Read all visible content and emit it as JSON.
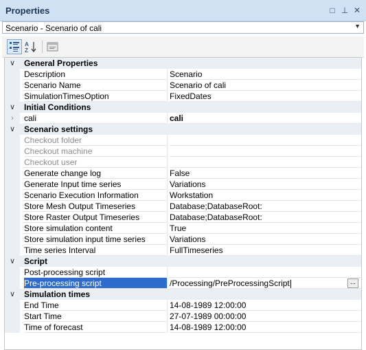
{
  "panel": {
    "title": "Properties",
    "controls": {
      "pin_icon": "□",
      "dock_icon": "⊥",
      "close_icon": "✕"
    }
  },
  "selector": {
    "value": "Scenario - Scenario of cali"
  },
  "toolbar": {
    "categorized_active": true
  },
  "grid": {
    "general": {
      "label": "General Properties",
      "description": {
        "name": "Description",
        "value": "Scenario"
      },
      "scenario_name": {
        "name": "Scenario Name",
        "value": "Scenario of cali"
      },
      "sim_times_option": {
        "name": "SimulationTimesOption",
        "value": "FixedDates"
      }
    },
    "initial": {
      "label": "Initial Conditions",
      "cali": {
        "name": "cali",
        "value": "cali"
      }
    },
    "settings": {
      "label": "Scenario settings",
      "checkout_folder": {
        "name": "Checkout folder",
        "value": ""
      },
      "checkout_machine": {
        "name": "Checkout machine",
        "value": ""
      },
      "checkout_user": {
        "name": "Checkout user",
        "value": ""
      },
      "gen_change_log": {
        "name": "Generate change log",
        "value": "False"
      },
      "gen_input_ts": {
        "name": "Generate Input time series",
        "value": "Variations"
      },
      "exec_info": {
        "name": "Scenario Execution Information",
        "value": "Workstation"
      },
      "mesh_output": {
        "name": "Store Mesh Output Timeseries",
        "value": "Database;DatabaseRoot:"
      },
      "raster_output": {
        "name": "Store Raster Output Timeseries",
        "value": "Database;DatabaseRoot:"
      },
      "sim_content": {
        "name": "Store simulation content",
        "value": "True"
      },
      "sim_input_ts": {
        "name": "Store simulation input time series",
        "value": "Variations"
      },
      "ts_interval": {
        "name": "Time series Interval",
        "value": "FullTimeseries"
      }
    },
    "script": {
      "label": "Script",
      "post": {
        "name": "Post-processing script",
        "value": ""
      },
      "pre": {
        "name": "Pre-processing script",
        "value": "/Processing/PreProcessingScript",
        "button": "..."
      }
    },
    "times": {
      "label": "Simulation times",
      "end": {
        "name": "End Time",
        "value": "14-08-1989 12:00:00"
      },
      "start": {
        "name": "Start Time",
        "value": "27-07-1989 00:00:00"
      },
      "forecast": {
        "name": "Time of forecast",
        "value": "14-08-1989 12:00:00"
      }
    }
  }
}
